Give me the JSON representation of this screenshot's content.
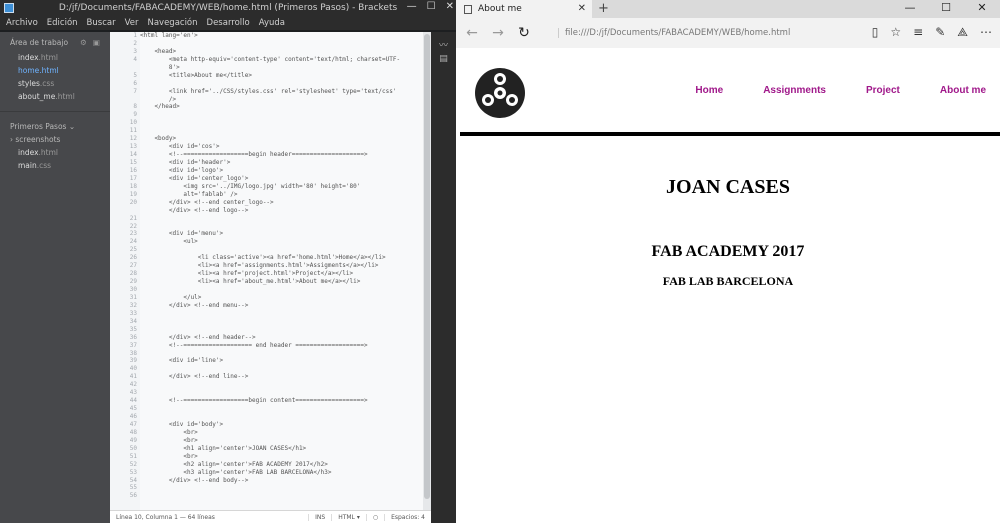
{
  "brackets": {
    "title": "D:/jf/Documents/FABACADEMY/WEB/home.html (Primeros Pasos) - Brackets",
    "menu": [
      "Archivo",
      "Edición",
      "Buscar",
      "Ver",
      "Navegación",
      "Desarrollo",
      "Ayuda"
    ],
    "sidebar": {
      "working_files_title": "Área de trabajo",
      "working_files": [
        {
          "name": "index",
          "ext": ".html"
        },
        {
          "name": "home",
          "ext": ".html"
        },
        {
          "name": "styles",
          "ext": ".css"
        },
        {
          "name": "about_me",
          "ext": ".html"
        }
      ],
      "project_title": "Primeros Pasos",
      "project_items": [
        {
          "name": "screenshots",
          "ext": ""
        },
        {
          "name": "index",
          "ext": ".html"
        },
        {
          "name": "main",
          "ext": ".css"
        }
      ]
    },
    "code_lines": [
      "<html lang='en'>",
      "",
      "    <head>",
      "        <meta http-equiv='content-type' content='text/html; charset=UTF-",
      "        8'>",
      "        <title>About me</title>",
      "",
      "        <link href='../CSS/styles.css' rel='stylesheet' type='text/css'",
      "        />",
      "    </head>",
      "",
      "",
      "",
      "    <body>",
      "        <div id='cos'>",
      "        <!--==================begin header====================>",
      "        <div id='header'>",
      "        <div id='logo'>",
      "        <div id='center_logo'>",
      "            <img src='../IMG/logo.jpg' width='80' height='80'",
      "            alt='fablab' />",
      "        </div> <!--end center_logo-->",
      "        </div> <!--end logo-->",
      "",
      "",
      "        <div id='menu'>",
      "            <ul>",
      "",
      "                <li class='active'><a href='home.html'>Home</a></li>",
      "                <li><a href='assignments.html'>Assigments</a></li>",
      "                <li><a href='project.html'>Project</a></li>",
      "                <li><a href='about_me.html'>About me</a></li>",
      "",
      "            </ul>",
      "        </div> <!--end menu-->",
      "",
      "",
      "",
      "        </div> <!--end header-->",
      "        <!--=================== end header ===================>",
      "",
      "        <div id='line'>",
      "",
      "        </div> <!--end line-->",
      "",
      "",
      "        <!--==================begin content===================>",
      "",
      "",
      "        <div id='body'>",
      "            <br>",
      "            <br>",
      "            <h1 align='center'>JOAN CASES</h1>",
      "            <br>",
      "            <h2 align='center'>FAB ACADEMY 2017</h2>",
      "            <h3 align='center'>FAB LAB BARCELONA</h3>",
      "        </div> <!--end body-->"
    ],
    "line_numbers": [
      "1",
      "2",
      "3",
      "4",
      "",
      "5",
      "6",
      "7",
      "",
      "8",
      "9",
      "10",
      "11",
      "12",
      "13",
      "14",
      "15",
      "16",
      "17",
      "18",
      "19",
      "20",
      "",
      "21",
      "22",
      "23",
      "24",
      "25",
      "26",
      "27",
      "28",
      "29",
      "30",
      "31",
      "32",
      "33",
      "34",
      "35",
      "36",
      "37",
      "38",
      "39",
      "40",
      "41",
      "42",
      "43",
      "44",
      "45",
      "46",
      "47",
      "48",
      "49",
      "50",
      "51",
      "52",
      "53",
      "54",
      "55",
      "56"
    ],
    "status": {
      "position": "Línea 10, Columna 1 — 64 líneas",
      "mode": "INS",
      "language": "HTML",
      "spaces": "Espacios: 4"
    }
  },
  "browser": {
    "tab_title": "About me",
    "url": "file:///D:/jf/Documents/FABACADEMY/WEB/home.html",
    "nav": [
      "Home",
      "Assignments",
      "Project",
      "About me"
    ],
    "heading": "JOAN CASES",
    "subheading": "FAB ACADEMY 2017",
    "subsubheading": "FAB LAB BARCELONA",
    "accent_color": "#a0188a"
  }
}
